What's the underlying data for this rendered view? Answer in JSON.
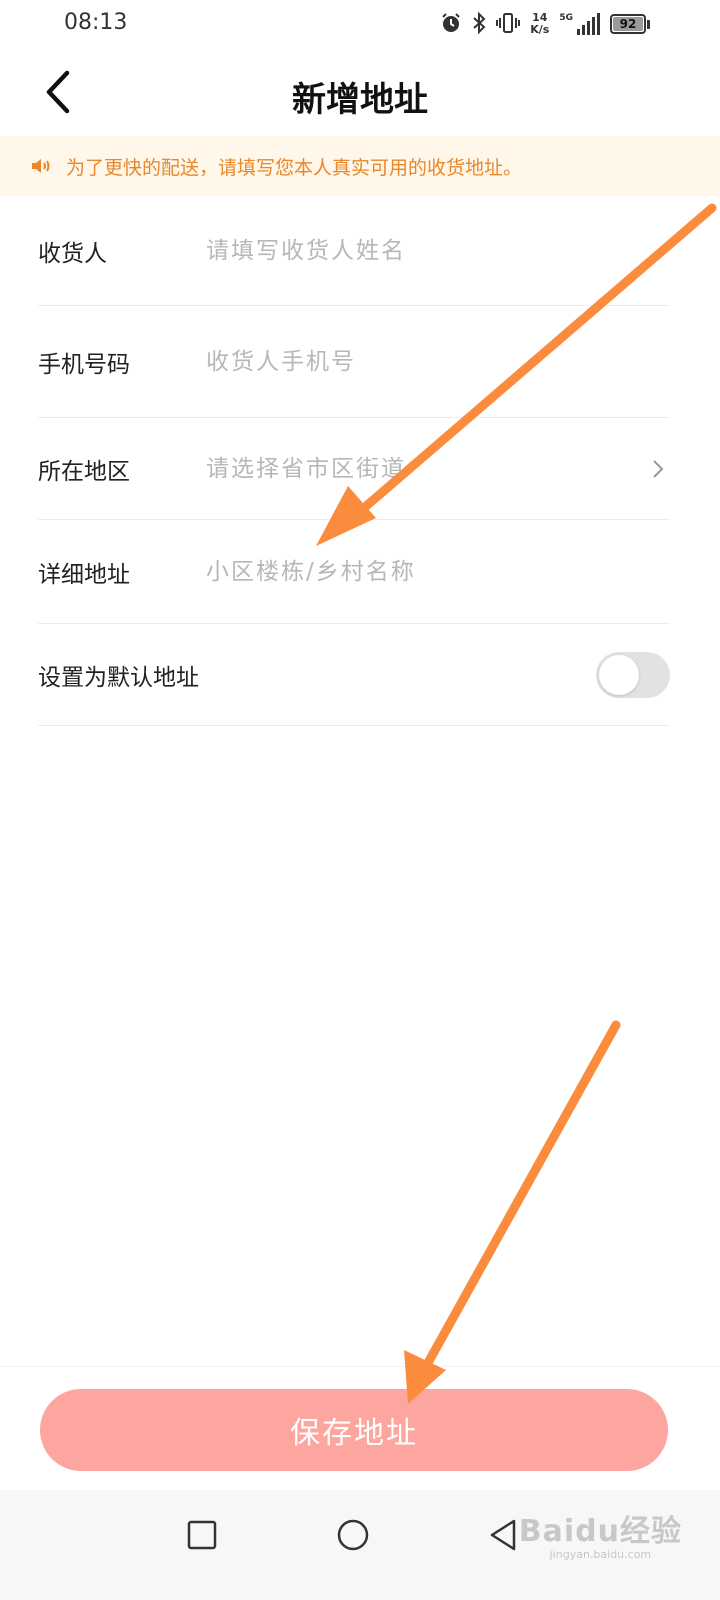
{
  "status_bar": {
    "time": "08:13",
    "net_speed_value": "14",
    "net_speed_unit": "K/s",
    "signal_label": "5G",
    "battery": "92"
  },
  "header": {
    "title": "新增地址"
  },
  "notice": {
    "text": "为了更快的配送，请填写您本人真实可用的收货地址。",
    "color": "#e8882b"
  },
  "form": {
    "recipient": {
      "label": "收货人",
      "placeholder": "请填写收货人姓名",
      "value": ""
    },
    "phone": {
      "label": "手机号码",
      "placeholder": "收货人手机号",
      "value": ""
    },
    "region": {
      "label": "所在地区",
      "placeholder": "请选择省市区街道",
      "value": ""
    },
    "detail": {
      "label": "详细地址",
      "placeholder": "小区楼栋/乡村名称",
      "value": ""
    },
    "default_address": {
      "label": "设置为默认地址",
      "enabled": false
    }
  },
  "footer": {
    "save_label": "保存地址",
    "save_color": "#fca69f"
  },
  "watermark": {
    "main": "Baidu经验",
    "sub": "jingyan.baidu.com"
  },
  "colors": {
    "accent_arrow": "#fb8c3d",
    "notice_bg": "#fff7ea"
  }
}
